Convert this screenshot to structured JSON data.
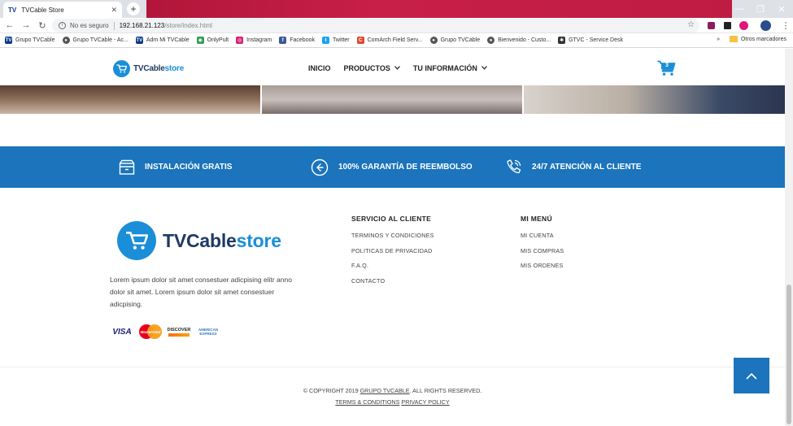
{
  "browser": {
    "tab_title": "TVCable Store",
    "tab_favicon": "TV",
    "security_label": "No es seguro",
    "url_host": "192.168.21.123",
    "url_path": "/store/index.html",
    "bookmarks": [
      {
        "label": "Grupo TVCable",
        "icon": "tv-logo-icon",
        "color": "#0b3a82"
      },
      {
        "label": "Grupo TVCable - Ac...",
        "icon": "globe-icon",
        "color": "#555555"
      },
      {
        "label": "Adm Mi TVCable",
        "icon": "tv-logo-icon",
        "color": "#0b3a82"
      },
      {
        "label": "OnlyPult",
        "icon": "onlypult-icon",
        "color": "#2e9d5b"
      },
      {
        "label": "Instagram",
        "icon": "instagram-icon",
        "color": "#d6246e"
      },
      {
        "label": "Facebook",
        "icon": "facebook-icon",
        "color": "#3b5998"
      },
      {
        "label": "Twitter",
        "icon": "twitter-icon",
        "color": "#1da1f2"
      },
      {
        "label": "ComArch Field Serv...",
        "icon": "comarch-icon",
        "color": "#e0462f"
      },
      {
        "label": "Grupo TVCable",
        "icon": "globe-icon",
        "color": "#555555"
      },
      {
        "label": "Bienvenido - Custo...",
        "icon": "globe-icon",
        "color": "#555555"
      },
      {
        "label": "GTVC - Service Desk",
        "icon": "service-desk-icon",
        "color": "#333333"
      }
    ],
    "bookmarks_more": "»",
    "other_bookmarks": "Otros marcadores"
  },
  "header": {
    "logo_main": "TVCable",
    "logo_store": "store",
    "nav": [
      {
        "label": "INICIO",
        "has_dropdown": false
      },
      {
        "label": "PRODUCTOS",
        "has_dropdown": true
      },
      {
        "label": "TU INFORMACIÓN",
        "has_dropdown": true
      }
    ],
    "cart_count": "3"
  },
  "features": [
    {
      "label": "INSTALACIÓN GRATIS",
      "icon": "box-icon"
    },
    {
      "label": "100% GARANTÍA DE REEMBOLSO",
      "icon": "arrow-left-circle-icon"
    },
    {
      "label": "24/7 ATENCIÓN AL CLIENTE",
      "icon": "phone-icon"
    }
  ],
  "footer": {
    "logo_main": "TVCable",
    "logo_store": "store",
    "about": "Lorem ipsum dolor sit amet consestuer adicpising elitr anno dolor sit amet. Lorem ipsum dolor sit amet consestuer adicpising.",
    "payments": [
      "VISA",
      "MasterCard",
      "DISCOVER",
      "AMERICAN EXPRESS"
    ],
    "service_title": "SERVICIO AL CLIENTE",
    "service_links": [
      "TERMINOS Y CONDICIONES",
      "POLITICAS DE PRIVACIDAD",
      "F.A.Q.",
      "CONTACTO"
    ],
    "menu_title": "MI MENÚ",
    "menu_links": [
      "MI CUENTA",
      "MIS COMPRAS",
      "MIS ORDENES"
    ],
    "copyright_prefix": "© COPYRIGHT 2019 ",
    "copyright_company": "GRUPO TVCABLE",
    "copyright_suffix": ". ALL RIGHTS RESERVED.",
    "terms_label": "TERMS & CONDITIONS",
    "privacy_label": "PRIVACY POLICY"
  },
  "colors": {
    "brand_blue": "#1b74bc",
    "logo_light_blue": "#1a8fd8",
    "logo_dark": "#1f3a63"
  }
}
